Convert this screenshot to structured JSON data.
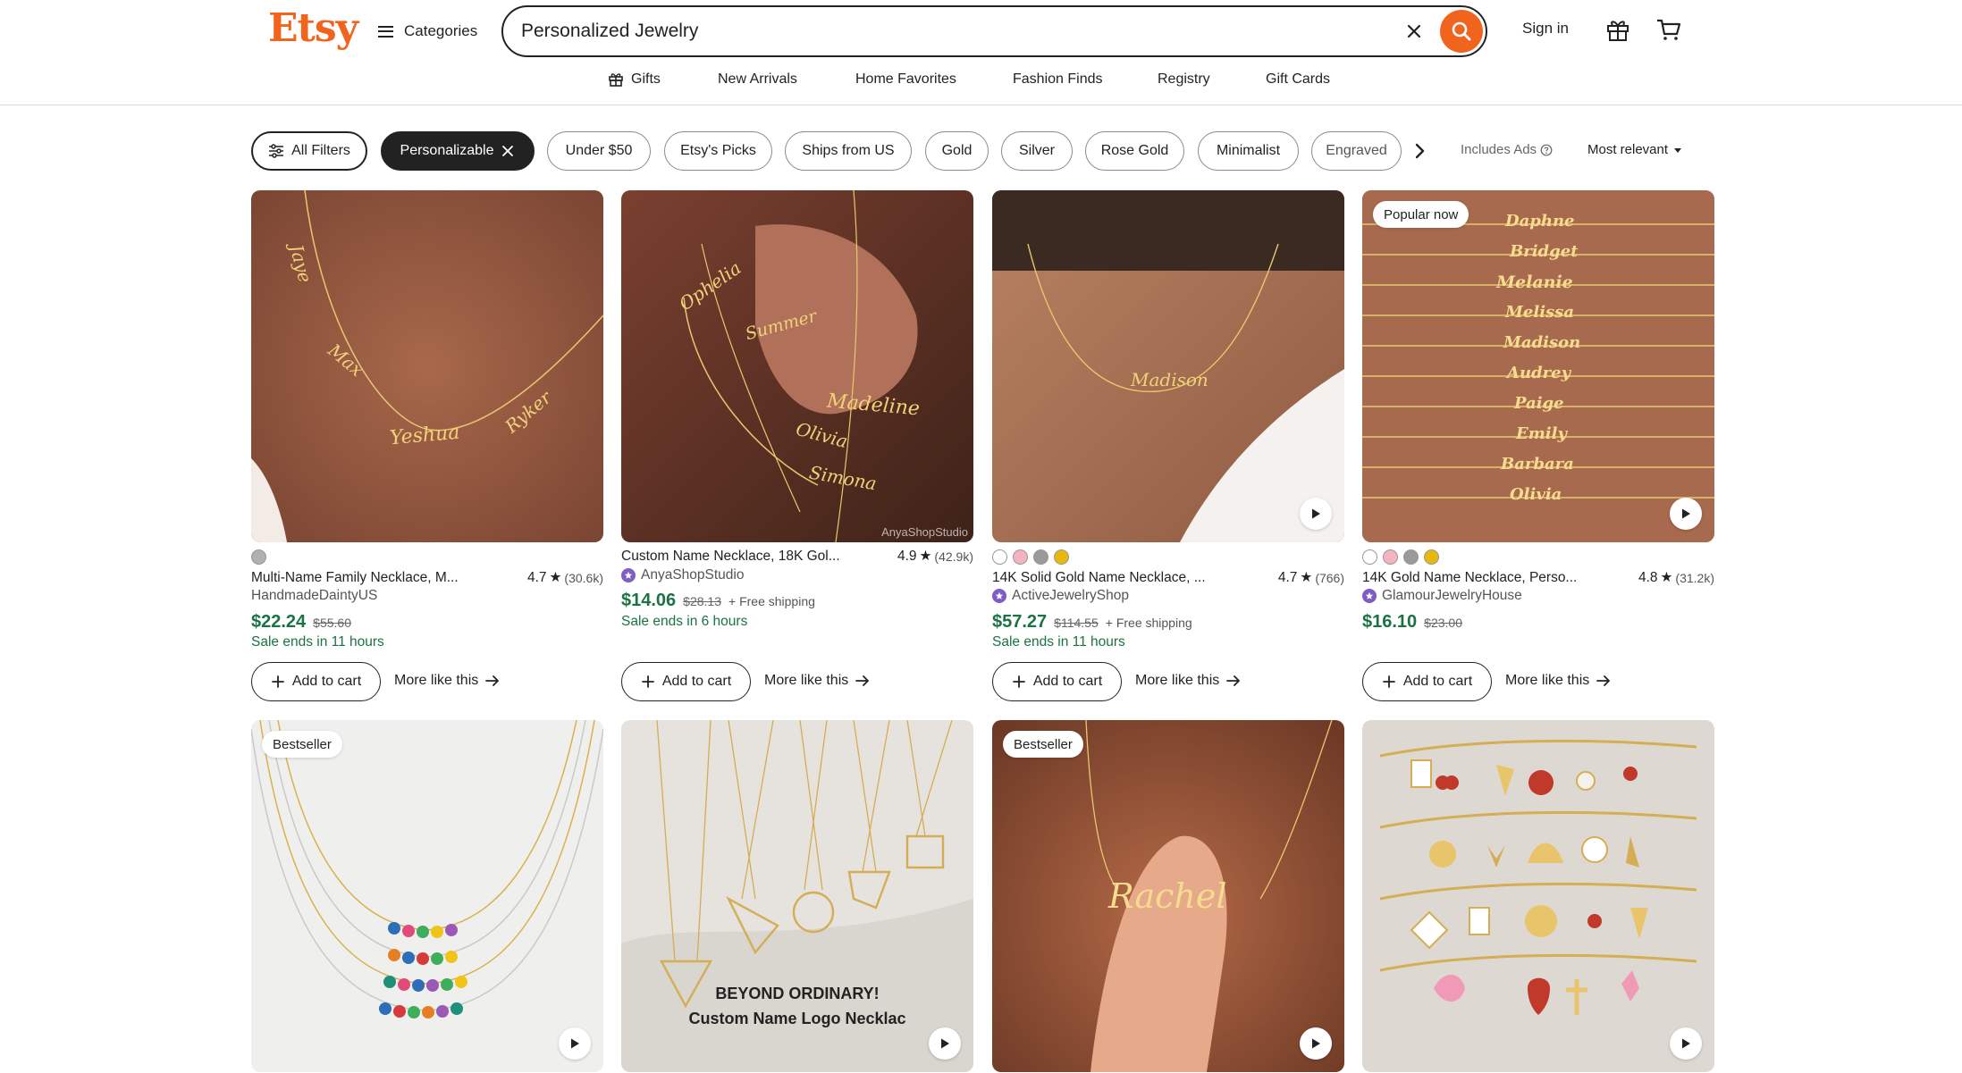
{
  "header": {
    "logo": "Etsy",
    "categories_label": "Categories",
    "search_value": "Personalized Jewelry",
    "signin_label": "Sign in"
  },
  "nav": [
    "Gifts",
    "New Arrivals",
    "Home Favorites",
    "Fashion Finds",
    "Registry",
    "Gift Cards"
  ],
  "filters": {
    "all_filters": "All Filters",
    "active": "Personalizable",
    "chips": [
      "Under $50",
      "Etsy's Picks",
      "Ships from US",
      "Gold",
      "Silver",
      "Rose Gold",
      "Minimalist",
      "Engraved"
    ],
    "ads_note": "Includes Ads",
    "sort": "Most relevant"
  },
  "colors": {
    "brand": "#f1641e",
    "price": "#1b7343",
    "star_seller": "#7f5cc6"
  },
  "products": [
    {
      "title": "Multi-Name Family Necklace, M...",
      "rating": "4.7",
      "reviews": "(30.6k)",
      "shop": "HandmadeDaintyUS",
      "star_seller": false,
      "price": "$22.24",
      "original": "$55.60",
      "shipping": "",
      "sale": "Sale ends in 11 hours",
      "swatches": [
        "#b0b0b0"
      ],
      "badge": "",
      "video": false,
      "names": [
        "Jaye",
        "Max",
        "Yeshua",
        "Ryker"
      ]
    },
    {
      "title": "Custom Name Necklace, 18K Gol...",
      "rating": "4.9",
      "reviews": "(42.9k)",
      "shop": "AnyaShopStudio",
      "star_seller": true,
      "price": "$14.06",
      "original": "$28.13",
      "shipping": "+ Free shipping",
      "sale": "Sale ends in 6 hours",
      "swatches": [],
      "badge": "",
      "video": false,
      "names": [
        "Ophelia",
        "Summer",
        "Madeline",
        "Olivia",
        "Simona"
      ],
      "watermark": "AnyaShopStudio"
    },
    {
      "title": "14K Solid Gold Name Necklace, ...",
      "rating": "4.7",
      "reviews": "(766)",
      "shop": "ActiveJewelryShop",
      "star_seller": true,
      "price": "$57.27",
      "original": "$114.55",
      "shipping": "+ Free shipping",
      "sale": "Sale ends in 11 hours",
      "swatches": [
        "#ffffff",
        "#f5b3c0",
        "#9a9a9a",
        "#e8b90c"
      ],
      "badge": "",
      "video": true,
      "names": [
        "Madison"
      ]
    },
    {
      "title": "14K Gold Name Necklace, Perso...",
      "rating": "4.8",
      "reviews": "(31.2k)",
      "shop": "GlamourJewelryHouse",
      "star_seller": true,
      "price": "$16.10",
      "original": "$23.00",
      "shipping": "",
      "sale": "",
      "swatches": [
        "#ffffff",
        "#f5b3c0",
        "#9a9a9a",
        "#e8b90c"
      ],
      "badge": "Popular now",
      "video": true,
      "names": [
        "Daphne",
        "Bridget",
        "Melanie",
        "Melissa",
        "Madison",
        "Audrey",
        "Paige",
        "Emily",
        "Barbara",
        "Olivia"
      ]
    },
    {
      "badge": "Bestseller",
      "video": true
    },
    {
      "badge": "",
      "video": true,
      "overlay_1": "BEYOND ORDINARY!",
      "overlay_2": "Custom Name Logo Necklac"
    },
    {
      "badge": "Bestseller",
      "video": true,
      "names": [
        "Rachel"
      ]
    },
    {
      "badge": "",
      "video": true
    }
  ],
  "card_actions": {
    "add_to_cart": "Add to cart",
    "more_like": "More like this"
  }
}
